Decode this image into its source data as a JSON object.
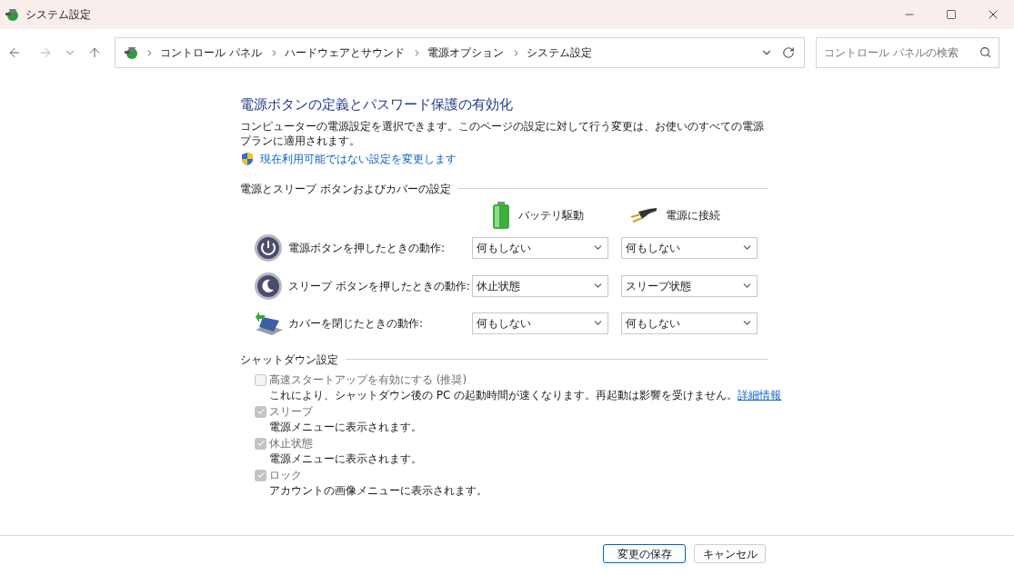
{
  "window": {
    "title": "システム設定"
  },
  "breadcrumb": [
    "コントロール パネル",
    "ハードウェアとサウンド",
    "電源オプション",
    "システム設定"
  ],
  "search": {
    "placeholder": "コントロール パネルの検索"
  },
  "page": {
    "title": "電源ボタンの定義とパスワード保護の有効化",
    "description": "コンピューターの電源設定を選択できます。このページの設定に対して行う変更は、お使いのすべての電源プランに適用されます。",
    "admin_link": "現在利用可能ではない設定を変更します"
  },
  "power_section": {
    "heading": "電源とスリープ ボタンおよびカバーの設定",
    "columns": [
      "バッテリ駆動",
      "電源に接続"
    ],
    "rows": [
      {
        "kind": "power",
        "label": "電源ボタンを押したときの動作:",
        "values": [
          "何もしない",
          "何もしない"
        ]
      },
      {
        "kind": "sleep",
        "label": "スリープ ボタンを押したときの動作:",
        "values": [
          "休止状態",
          "スリープ状態"
        ]
      },
      {
        "kind": "lid",
        "label": "カバーを閉じたときの動作:",
        "values": [
          "何もしない",
          "何もしない"
        ]
      }
    ]
  },
  "shutdown_section": {
    "heading": "シャットダウン設定",
    "options": [
      {
        "label": "高速スタートアップを有効にする (推奨)",
        "description": "これにより、シャットダウン後の PC の起動時間が速くなります。再起動は影響を受けません。",
        "checked": false,
        "disabled": true,
        "link": "詳細情報"
      },
      {
        "label": "スリープ",
        "description": "電源メニューに表示されます。",
        "checked": true,
        "disabled": true
      },
      {
        "label": "休止状態",
        "description": "電源メニューに表示されます。",
        "checked": true,
        "disabled": true
      },
      {
        "label": "ロック",
        "description": "アカウントの画像メニューに表示されます。",
        "checked": true,
        "disabled": true
      }
    ]
  },
  "buttons": [
    {
      "label": "変更の保存",
      "default": true
    },
    {
      "label": "キャンセル",
      "default": false
    }
  ]
}
